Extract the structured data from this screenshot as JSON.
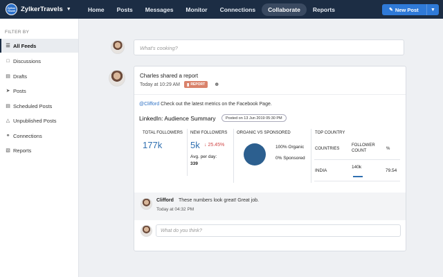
{
  "header": {
    "brand_logo_text": "Zylker Travel",
    "brand_name": "ZylkerTravels",
    "nav": [
      {
        "label": "Home"
      },
      {
        "label": "Posts"
      },
      {
        "label": "Messages"
      },
      {
        "label": "Monitor"
      },
      {
        "label": "Connections"
      },
      {
        "label": "Collaborate",
        "active": true
      },
      {
        "label": "Reports"
      }
    ],
    "new_post_label": "New Post",
    "accent": "#2f7ad8",
    "bg": "#1c2d44"
  },
  "sidebar": {
    "filter_label": "FILTER BY",
    "items": [
      {
        "label": "All Feeds",
        "icon": "list-icon",
        "active": true
      },
      {
        "label": "Discussions",
        "icon": "chat-icon"
      },
      {
        "label": "Drafts",
        "icon": "draft-icon"
      },
      {
        "label": "Posts",
        "icon": "send-icon"
      },
      {
        "label": "Scheduled Posts",
        "icon": "calendar-icon"
      },
      {
        "label": "Unpublished Posts",
        "icon": "warning-icon"
      },
      {
        "label": "Connections",
        "icon": "connections-icon"
      },
      {
        "label": "Reports",
        "icon": "reports-icon"
      }
    ]
  },
  "composer": {
    "placeholder": "What's cooking?"
  },
  "post": {
    "title": "Charles shared a report",
    "time": "Today at 10:29 AM",
    "badge": "REPORT",
    "mention": "@Clifford",
    "message": "Check out the latest metrics on the Facebook Page.",
    "report": {
      "title": "LinkedIn: Audience Summary",
      "posted": "Posted on 13 Jun 2019 05:30 PM",
      "total_followers_label": "TOTAL FOLLOWERS",
      "total_followers": "177k",
      "new_followers_label": "NEW FOLLOWERS",
      "new_followers": "5k",
      "change": "25.45%",
      "avg_label": "Avg. per day:",
      "avg_value": "339",
      "organic_label": "ORGANIC VS SPONSORED",
      "organic": "100% Organic",
      "sponsored": "0% Sponsored",
      "top_country_label": "TOP COUNTRY",
      "col_countries": "COUNTRIES",
      "col_follower_count": "FOLLOWER COUNT",
      "col_pct": "%",
      "row_country": "INDIA",
      "row_count": "140k",
      "row_pct": "79.54"
    },
    "comment": {
      "author": "Clifford",
      "text": "These numbers look great! Great job.",
      "time": "Today at 04:32 PM"
    },
    "reply_placeholder": "What do you think?"
  }
}
